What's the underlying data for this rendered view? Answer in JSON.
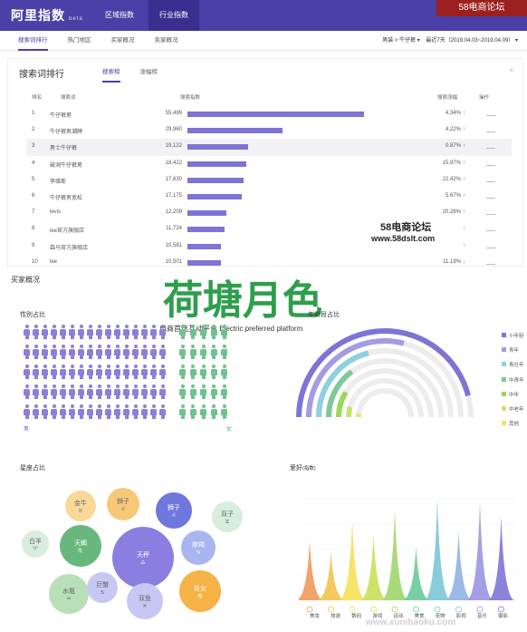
{
  "header": {
    "brand": "阿里指数",
    "brand_beta": "beta",
    "nav": [
      "区域指数",
      "行业指数"
    ],
    "forum_tag": "58电商论坛"
  },
  "subnav": {
    "items": [
      "搜索词排行",
      "热门地区",
      "买家概况",
      "卖家概况"
    ],
    "filter_category": "男装 > 牛仔裤",
    "filter_range": "最近7天（2019.04.03~2019.04.09）"
  },
  "search_rank": {
    "title": "搜索词排行",
    "tabs": [
      "搜索榜",
      "涨幅榜"
    ],
    "share_icon": "share-icon",
    "columns": [
      "排名",
      "搜索词",
      "搜索指数",
      "搜索涨幅",
      "操作"
    ],
    "rows": [
      {
        "rank": "1",
        "term": "牛仔裤男",
        "index": "55,499",
        "value": 55499,
        "growth": "4.34%",
        "dir": "up"
      },
      {
        "rank": "2",
        "term": "牛仔裤男潮牌",
        "index": "29,960",
        "value": 29960,
        "growth": "4.22%",
        "dir": "up"
      },
      {
        "rank": "3",
        "term": "男士牛仔裤",
        "index": "19,122",
        "value": 19122,
        "growth": "0.87%",
        "dir": "up"
      },
      {
        "rank": "4",
        "term": "破洞牛仔裤男",
        "index": "18,422",
        "value": 18422,
        "growth": "15.97%",
        "dir": "up"
      },
      {
        "rank": "5",
        "term": "李维斯",
        "index": "17,630",
        "value": 17630,
        "growth": "22.42%",
        "dir": "up"
      },
      {
        "rank": "6",
        "term": "牛仔裤男宽松",
        "index": "17,175",
        "value": 17175,
        "growth": "5.67%",
        "dir": "up"
      },
      {
        "rank": "7",
        "term": "levis",
        "index": "12,209",
        "value": 12209,
        "growth": "20.26%",
        "dir": "up"
      },
      {
        "rank": "8",
        "term": "lee官方旗舰店",
        "index": "11,724",
        "value": 11724,
        "growth": "",
        "dir": "up"
      },
      {
        "rank": "9",
        "term": "森马官方旗舰店",
        "index": "10,581",
        "value": 10581,
        "growth": "",
        "dir": "up"
      },
      {
        "rank": "10",
        "term": "lee",
        "index": "10,501",
        "value": 10501,
        "growth": "11.19%",
        "dir": "down"
      }
    ]
  },
  "watermark": {
    "forum": "58电商论坛",
    "site": "www.58dslt.com",
    "site_bottom": "www.xunibaoku.com"
  },
  "buyer": {
    "title": "买家概况",
    "logo_text": "荷塘月色",
    "logo_sub": "电商首选互动平台 Electric preferred platform"
  },
  "gender": {
    "title": "性别占比",
    "male_label": "男",
    "female_label": "女",
    "male_color": "#8a80dc",
    "female_color": "#6ec28e",
    "male_share": 0.88
  },
  "age": {
    "title": "年龄段占比",
    "legend": [
      {
        "label": "小年轻",
        "color": "#7e74d6",
        "value": 0.92
      },
      {
        "label": "青年",
        "color": "#a49ce2",
        "value": 0.58
      },
      {
        "label": "青壮年",
        "color": "#8ecfe0",
        "value": 0.42
      },
      {
        "label": "中青年",
        "color": "#7ec99a",
        "value": 0.3
      },
      {
        "label": "中年",
        "color": "#9cd85c",
        "value": 0.18
      },
      {
        "label": "中老年",
        "color": "#c7e36e",
        "value": 0.09
      },
      {
        "label": "其他",
        "color": "#f0e36a",
        "value": 0.04
      }
    ]
  },
  "constellation": {
    "title": "星座占比",
    "items": [
      {
        "name": "金牛",
        "glyph": "♉",
        "color": "#f9d99a"
      },
      {
        "name": "狮子",
        "glyph": "♌",
        "color": "#f6c979"
      },
      {
        "name": "狮子",
        "glyph": "♌",
        "color": "#6f76dc"
      },
      {
        "name": "双子",
        "glyph": "♊",
        "color": "#d8eedd"
      },
      {
        "name": "白羊",
        "glyph": "♈",
        "color": "#d9ece0"
      },
      {
        "name": "天蝎",
        "glyph": "♏",
        "color": "#68b87e"
      },
      {
        "name": "天秤",
        "glyph": "♎",
        "color": "#8a7fe0"
      },
      {
        "name": "摩羯",
        "glyph": "♑",
        "color": "#a8b6f0"
      },
      {
        "name": "水瓶",
        "glyph": "♒",
        "color": "#b8dfb8"
      },
      {
        "name": "巨蟹",
        "glyph": "♋",
        "color": "#c6c8f4"
      },
      {
        "name": "双鱼",
        "glyph": "♓",
        "color": "#c8c6f2"
      },
      {
        "name": "处女",
        "glyph": "♍",
        "color": "#f4b247"
      }
    ]
  },
  "hobby": {
    "title": "爱好",
    "title_note": "(指数)",
    "labels": [
      "美妆",
      "旅游",
      "数码",
      "游戏",
      "运动",
      "美食",
      "宠物",
      "影视",
      "音乐",
      "摄影"
    ],
    "colors": [
      "#f09a5a",
      "#f3c34c",
      "#f6e05a",
      "#c9e05a",
      "#9fd66c",
      "#6ac99a",
      "#7bc7d6",
      "#8fb2e6",
      "#9b95e2",
      "#7e74d6"
    ],
    "values": [
      0.55,
      0.45,
      0.75,
      0.62,
      0.85,
      0.5,
      0.95,
      0.65,
      0.92,
      0.78
    ]
  }
}
